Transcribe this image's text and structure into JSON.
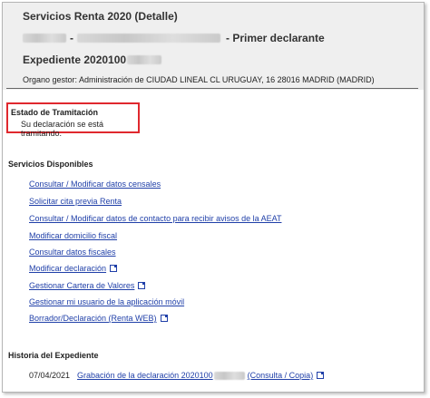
{
  "header": {
    "title": "Servicios Renta 2020 (Detalle)",
    "declarant_role": "- Primer declarante",
    "expediente_label": "Expediente 2020100",
    "organo": "Organo gestor: Administración de CIUDAD LINEAL  CL URUGUAY, 16 28016 MADRID (MADRID)"
  },
  "estado": {
    "title": "Estado de Tramitación",
    "value": "Su declaración se está tramitando."
  },
  "servicios": {
    "title": "Servicios Disponibles",
    "items": [
      {
        "label": "Consultar / Modificar datos censales",
        "external": false
      },
      {
        "label": "Solicitar cita previa Renta",
        "external": false
      },
      {
        "label": "Consultar / Modificar datos de contacto para recibir avisos de la AEAT",
        "external": false
      },
      {
        "label": "Modificar domicilio fiscal",
        "external": false
      },
      {
        "label": "Consultar datos fiscales",
        "external": false
      },
      {
        "label": "Modificar declaración",
        "external": true
      },
      {
        "label": "Gestionar Cartera de Valores",
        "external": true
      },
      {
        "label": "Gestionar mi usuario de la aplicación móvil",
        "external": false
      },
      {
        "label": "Borrador/Declaración (Renta WEB)",
        "external": true
      }
    ]
  },
  "historia": {
    "title": "Historia del Expediente",
    "date": "07/04/2021",
    "link_prefix": "Grabación de la declaración 2020100",
    "link_suffix": "(Consulta / Copia)"
  },
  "colors": {
    "link": "#1f3fa8",
    "highlight_border": "#e0282e",
    "header_bg": "#efefef"
  }
}
